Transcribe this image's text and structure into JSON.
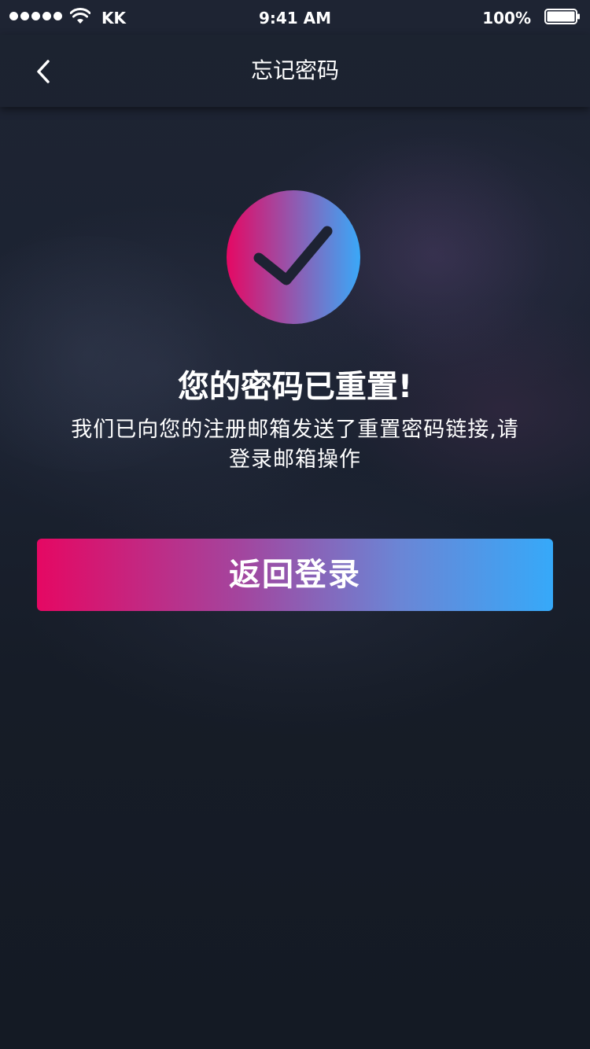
{
  "status_bar": {
    "carrier": "KK",
    "time": "9:41 AM",
    "battery_percent": "100%",
    "signal_icon": "signal-dots-icon",
    "wifi_icon": "wifi-icon",
    "battery_icon": "battery-icon"
  },
  "nav": {
    "title": "忘记密码",
    "back_icon": "chevron-left-icon"
  },
  "result": {
    "icon": "checkmark-icon",
    "headline": "您的密码已重置!",
    "message_line1": "我们已向您的注册邮箱发送了重置密码链接,请",
    "message_line2": "登录邮箱操作"
  },
  "actions": {
    "back_to_login_label": "返回登录"
  },
  "colors": {
    "gradient_start": "#e50863",
    "gradient_end": "#36a9f9",
    "background": "#161c27"
  }
}
